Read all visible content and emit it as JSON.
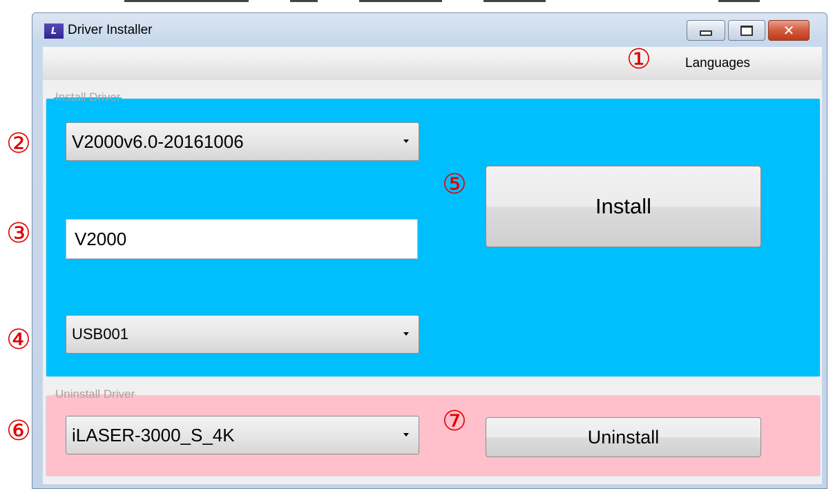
{
  "window": {
    "title": "Driver Installer",
    "icon_name": "app-logo-icon",
    "controls": {
      "minimize_icon": "minimize-icon",
      "maximize_icon": "maximize-icon",
      "close_glyph": "✕"
    }
  },
  "menu": {
    "languages_label": "Languages"
  },
  "install_group": {
    "legend": "Install Driver",
    "background_color": "#00bfff",
    "version_select": {
      "selected": "V2000v6.0-20161006"
    },
    "name_input": {
      "value": "V2000"
    },
    "port_select": {
      "selected": "USB001"
    },
    "install_button_label": "Install"
  },
  "uninstall_group": {
    "legend": "Uninstall Driver",
    "background_color": "#ffc0cb",
    "driver_select": {
      "selected": "iLASER-3000_S_4K"
    },
    "uninstall_button_label": "Uninstall"
  },
  "markers": {
    "m1": "①",
    "m2": "②",
    "m3": "③",
    "m4": "④",
    "m5": "⑤",
    "m6": "⑥",
    "m7": "⑦",
    "color": "#e00000"
  }
}
